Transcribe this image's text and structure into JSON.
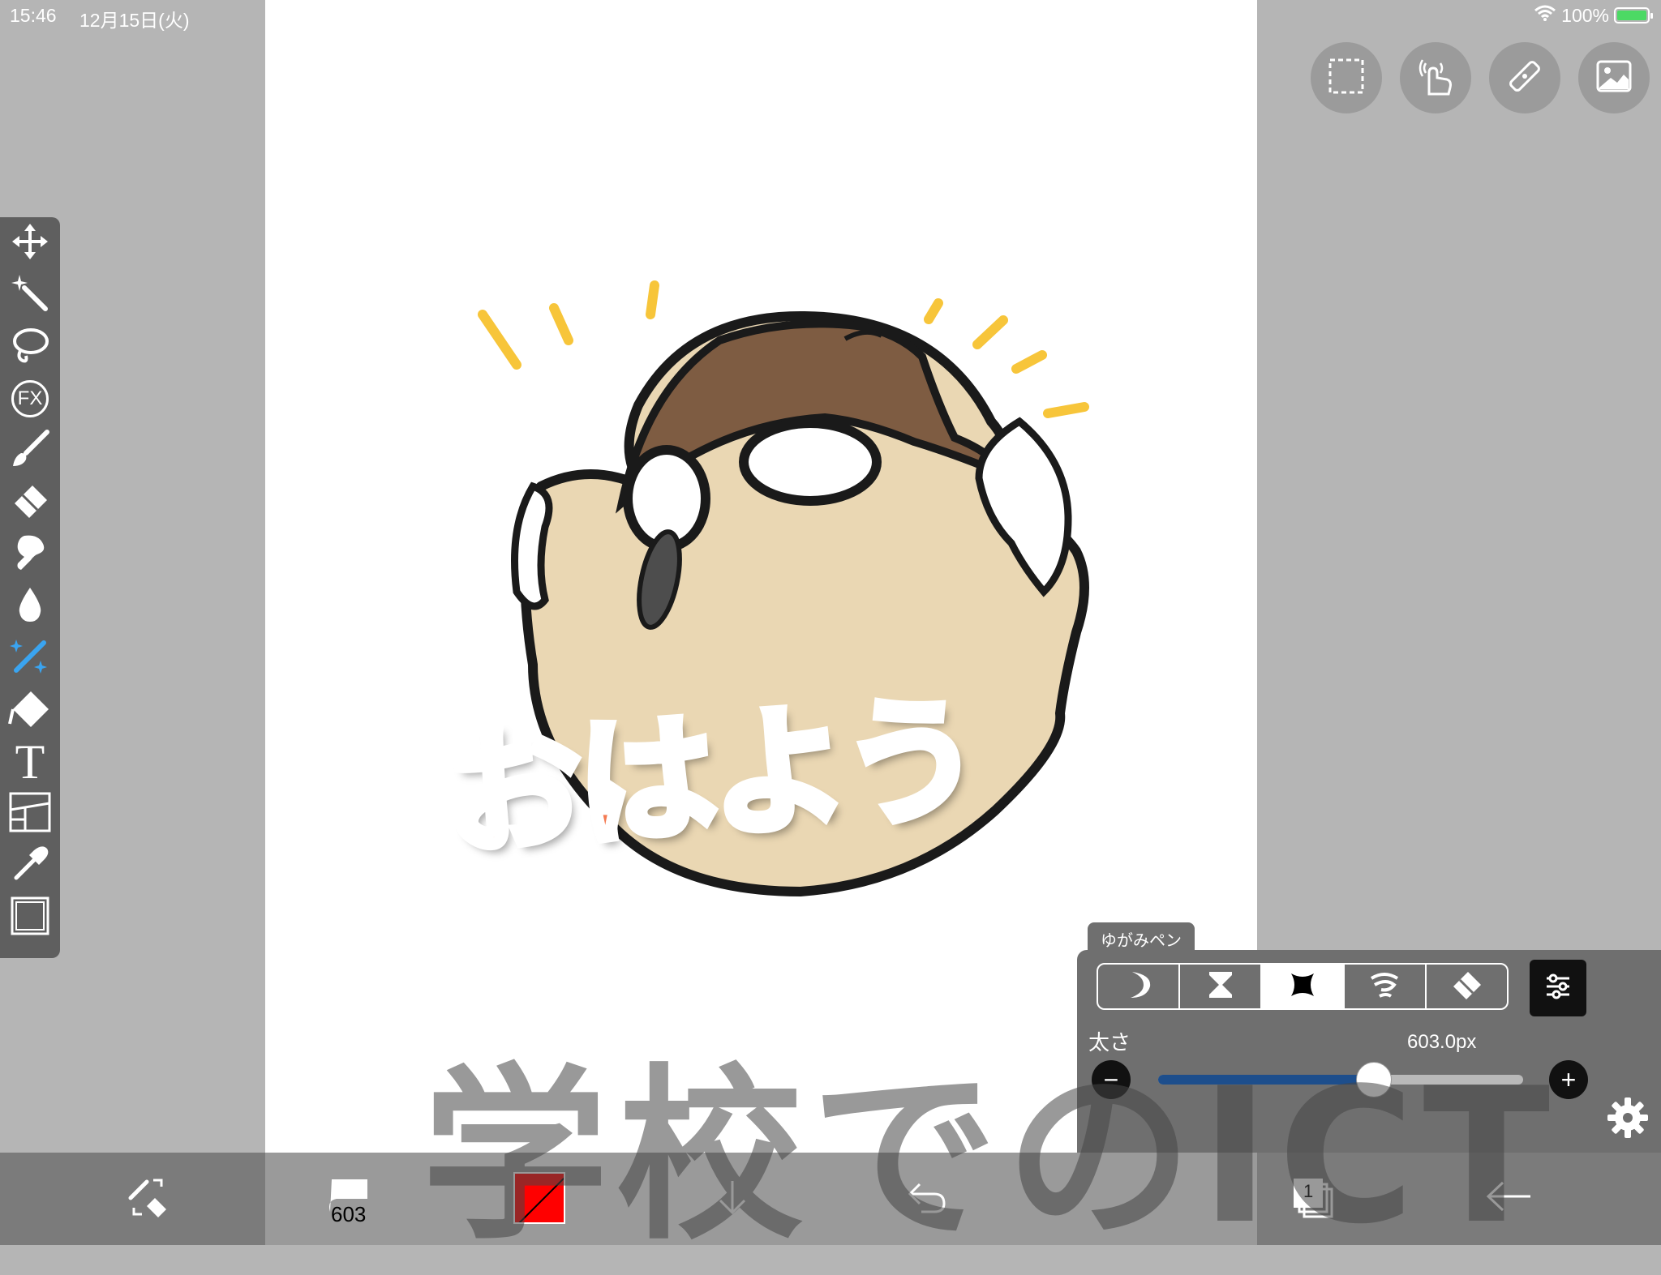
{
  "status": {
    "time": "15:46",
    "date": "12月15日(火)",
    "battery_percent": "100%",
    "battery_level": 1.0
  },
  "canvas": {
    "sticker_text": "おはよう",
    "colors": {
      "skin": "#ead7b3",
      "hair": "#7e5c42",
      "text_fill": "#f47a52",
      "accent_lines": "#f7c53a"
    }
  },
  "watermark": {
    "text": "学校でのICT"
  },
  "top_tools": [
    {
      "name": "selection",
      "icon": "selection-rect-icon"
    },
    {
      "name": "gesture",
      "icon": "hand-touch-icon"
    },
    {
      "name": "ruler",
      "icon": "ruler-icon"
    },
    {
      "name": "material",
      "icon": "image-icon"
    }
  ],
  "left_toolbar": {
    "tools": [
      {
        "name": "transform",
        "icon": "move-arrows-icon"
      },
      {
        "name": "magic-wand",
        "icon": "magic-wand-icon"
      },
      {
        "name": "lasso",
        "icon": "lasso-icon"
      },
      {
        "name": "filter",
        "icon": "fx-icon",
        "label": "FX"
      },
      {
        "name": "brush",
        "icon": "brush-icon"
      },
      {
        "name": "eraser",
        "icon": "eraser-icon"
      },
      {
        "name": "smudge",
        "icon": "smudge-icon"
      },
      {
        "name": "blur",
        "icon": "drop-icon"
      },
      {
        "name": "special-brush",
        "icon": "sparkle-brush-icon",
        "active": true
      },
      {
        "name": "fill",
        "icon": "bucket-icon"
      },
      {
        "name": "text",
        "icon": "text-icon",
        "label": "T"
      },
      {
        "name": "frame-divider",
        "icon": "frame-icon"
      },
      {
        "name": "eyedropper",
        "icon": "eyedropper-icon"
      },
      {
        "name": "canvas",
        "icon": "canvas-icon"
      }
    ]
  },
  "brush_panel": {
    "tab_label": "ゆがみペン",
    "brush_types": [
      {
        "name": "crescent",
        "icon": "crescent-icon"
      },
      {
        "name": "hourglass",
        "icon": "hourglass-icon"
      },
      {
        "name": "pinch",
        "icon": "pinch-icon",
        "active": true
      },
      {
        "name": "swirl",
        "icon": "swirl-icon"
      },
      {
        "name": "eraser",
        "icon": "eraser-icon"
      }
    ],
    "size_label": "太さ",
    "size_value": "603.0px",
    "size_fraction": 0.59,
    "minus_label": "−",
    "plus_label": "+"
  },
  "bottom_bar": {
    "brush_size_label": "603",
    "color": "#ff0000",
    "layer_count": "1"
  }
}
